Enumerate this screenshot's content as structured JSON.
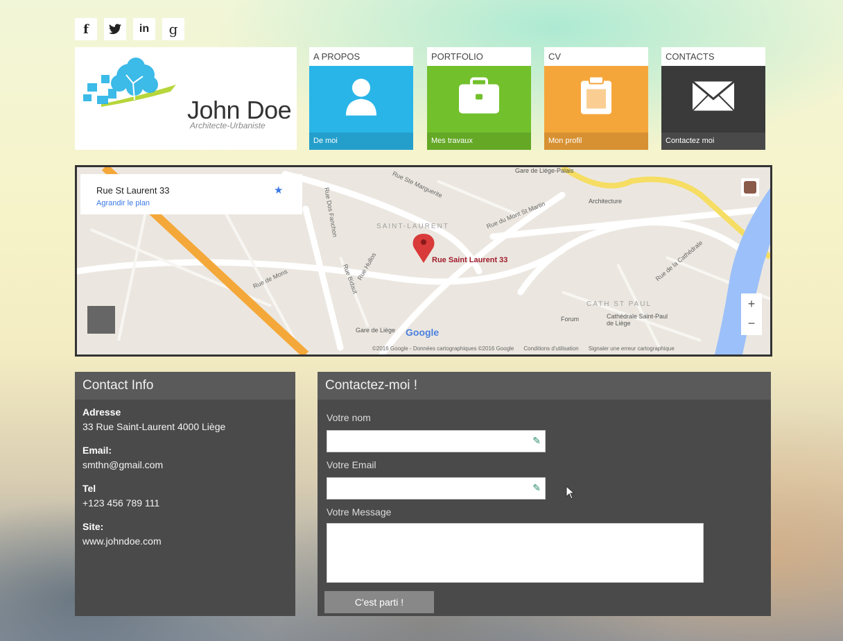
{
  "social": [
    {
      "name": "facebook-icon",
      "glyph": "f"
    },
    {
      "name": "twitter-icon",
      "glyph": "🐦"
    },
    {
      "name": "linkedin-icon",
      "glyph": "in"
    },
    {
      "name": "google-icon",
      "glyph": "g"
    }
  ],
  "logo": {
    "name": "John Doe",
    "subtitle": "Architecte-Urbaniste"
  },
  "tiles": [
    {
      "title": "A PROPOS",
      "caption": "De moi",
      "color": "#29b5e8"
    },
    {
      "title": "PORTFOLIO",
      "caption": "Mes travaux",
      "color": "#72c02c"
    },
    {
      "title": "CV",
      "caption": "Mon profil",
      "color": "#f5a63a"
    },
    {
      "title": "CONTACTS",
      "caption": "Contactez moi",
      "color": "#3a3a3a"
    }
  ],
  "map": {
    "place_title": "Rue St Laurent 33",
    "place_link": "Agrandir le plan",
    "marker_label": "Rue Saint Laurent 33",
    "district": "SAINT-LAURENT",
    "district2": "CATH ST PAUL",
    "labels": {
      "gare_saint_lambert": "Gare de Liège-Palais",
      "architecture": "Architecture",
      "rue_marguerite": "Rue Ste Marguerite",
      "mont_st_martin": "Rue du Mont St Martin",
      "rue_mons": "Rue de Mons",
      "rue_hullos": "Rue Hullos",
      "cathedrale": "Cathédrale Saint-Paul de Liège",
      "forum": "Forum",
      "gare_liege": "Gare de Liège",
      "rue_cathedrale": "Rue de la Cathédrale",
      "rue_dos_fanchon": "Rue Dos Fanchon",
      "rue_bidaut": "Rue Bidaut"
    },
    "zoom_in": "+",
    "zoom_out": "−",
    "footer": {
      "copyright": "©2016 Google - Données cartographiques ©2016 Google",
      "terms": "Conditions d'utilisation",
      "report": "Signaler une erreur cartographique"
    },
    "google_logo": "Google"
  },
  "contact_info": {
    "heading": "Contact Info",
    "address_label": "Adresse",
    "address": "33 Rue Saint-Laurent 4000 Liège",
    "email_label": "Email:",
    "email": "smthn@gmail.com",
    "tel_label": "Tel",
    "tel": "+123 456 789 111",
    "site_label": "Site:",
    "site": "www.johndoe.com"
  },
  "contact_form": {
    "heading": "Contactez-moi !",
    "name_label": "Votre nom",
    "email_label": "Votre Email",
    "message_label": "Votre Message",
    "name_value": "",
    "email_value": "",
    "message_value": "",
    "submit": "C'est parti !"
  }
}
